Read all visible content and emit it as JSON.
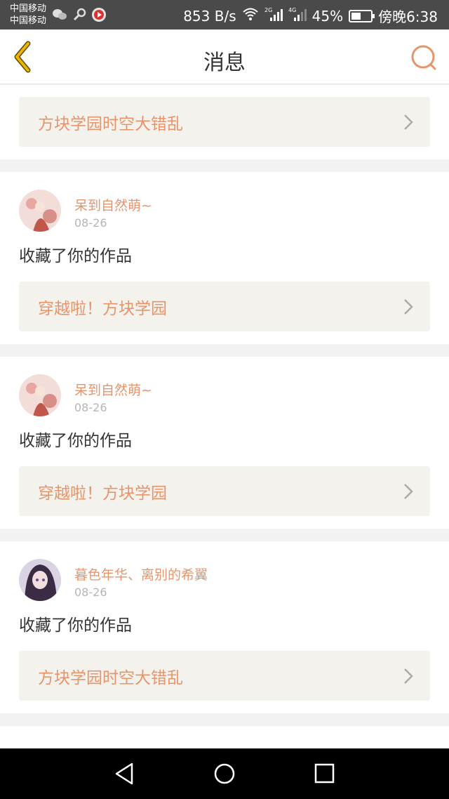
{
  "status_bar": {
    "carrier1": "中国移动",
    "carrier2": "中国移动",
    "speed": "853 B/s",
    "battery": "45%",
    "time": "傍晚6:38"
  },
  "header": {
    "title": "消息"
  },
  "items": [
    {
      "work": "方块学园时空大错乱"
    },
    {
      "user": "呆到自然萌~",
      "date": "08-26",
      "action": "收藏了你的作品",
      "work": "穿越啦！方块学园"
    },
    {
      "user": "呆到自然萌~",
      "date": "08-26",
      "action": "收藏了你的作品",
      "work": "穿越啦！方块学园"
    },
    {
      "user": "暮色年华、离别的希翼",
      "date": "08-26",
      "action": "收藏了你的作品",
      "work": "方块学园时空大错乱"
    }
  ],
  "colors": {
    "accent": "#e8946a",
    "link_bg": "#f4f2ec",
    "back": "#e8a800"
  }
}
